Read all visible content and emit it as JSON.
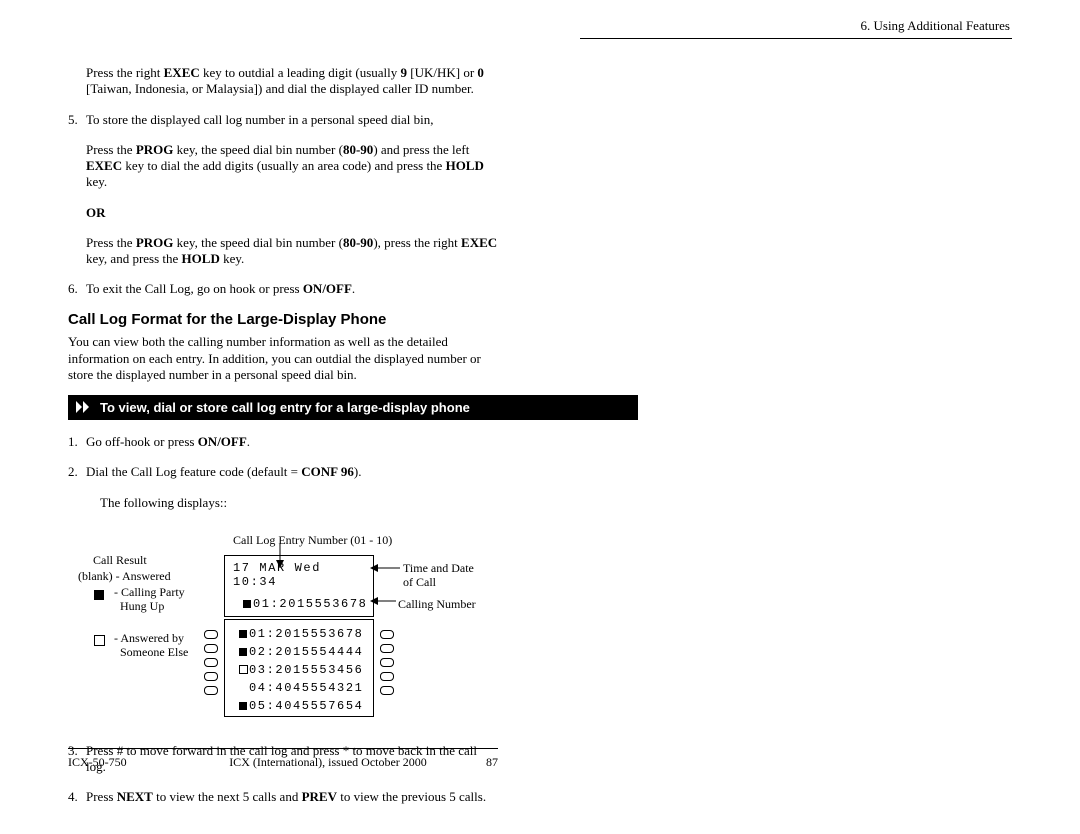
{
  "header": {
    "chapter": "6. Using Additional Features"
  },
  "top_paras": {
    "p1a": "Press the right ",
    "p1b": "EXEC",
    "p1c": " key to outdial a leading digit (usually ",
    "p1d": "9",
    "p1e": " [UK/HK] or ",
    "p1f": "0",
    "p1g": " [Taiwan, Indonesia, or Malaysia]) and dial the displayed caller ID number."
  },
  "step5": {
    "num": "5.",
    "lead": "To store the displayed call log number in a personal speed dial bin,",
    "a1": "Press the  ",
    "a2": "PROG",
    "a3": " key, the speed dial bin number (",
    "a4": "80-90",
    "a5": ") and press the left ",
    "a6": "EXEC",
    "a7": " key to dial the add digits (usually an area code) and press the ",
    "a8": "HOLD",
    "a9": " key.",
    "or": "OR",
    "b1": "Press the ",
    "b2": "PROG",
    "b3": " key, the speed dial bin number (",
    "b4": "80-90",
    "b5": "), press the right ",
    "b6": "EXEC",
    "b7": " key, and press the ",
    "b8": "HOLD",
    "b9": " key."
  },
  "step6": {
    "num": "6.",
    "a1": "To exit the Call Log, go on hook or press ",
    "a2": "ON/OFF",
    "a3": "."
  },
  "section": {
    "title": "Call Log Format for the Large-Display Phone",
    "intro": "You can view both the calling number information as well as the detailed information on each entry. In addition, you can outdial the displayed number or store the displayed number in a personal speed dial bin."
  },
  "blackbar": {
    "text": "To view, dial or store  call log entry for a large-display phone"
  },
  "proc": {
    "s1num": "1.",
    "s1a": "Go off-hook or press ",
    "s1b": "ON/OFF",
    "s1c": ".",
    "s2num": "2.",
    "s2a": "Dial the Call Log feature code (default = ",
    "s2b": "CONF 96",
    "s2c": ").",
    "following": "The following displays::"
  },
  "figure": {
    "entry_label": "Call Log Entry Number (01 - 10)",
    "call_result_label": "Call Result",
    "blank_answered": "(blank) - Answered",
    "calling_party": "- Calling Party",
    "hung_up": "  Hung Up",
    "answered_by": "- Answered by",
    "someone_else": "  Someone Else",
    "time_date_label": "Time and Date",
    "of_call": "of Call",
    "calling_number_label": "Calling Number",
    "display": {
      "header": "17 MAR  Wed  10:34",
      "main": "01:2015553678",
      "rows": {
        "r1": "01:2015553678",
        "r2": "02:2015554444",
        "r3": "03:2015553456",
        "r4": "04:4045554321",
        "r5": "05:4045557654"
      }
    }
  },
  "after": {
    "s3num": "3.",
    "s3": "Press # to move forward in the call log and press * to move back in the call log.",
    "s4num": "4.",
    "s4a": "Press ",
    "s4b": "NEXT",
    "s4c": " to view the next 5 calls and ",
    "s4d": "PREV",
    "s4e": " to view the previous 5 calls."
  },
  "footer": {
    "left": "ICX-50-750",
    "mid": "ICX (International), issued October 2000",
    "right": "87"
  }
}
